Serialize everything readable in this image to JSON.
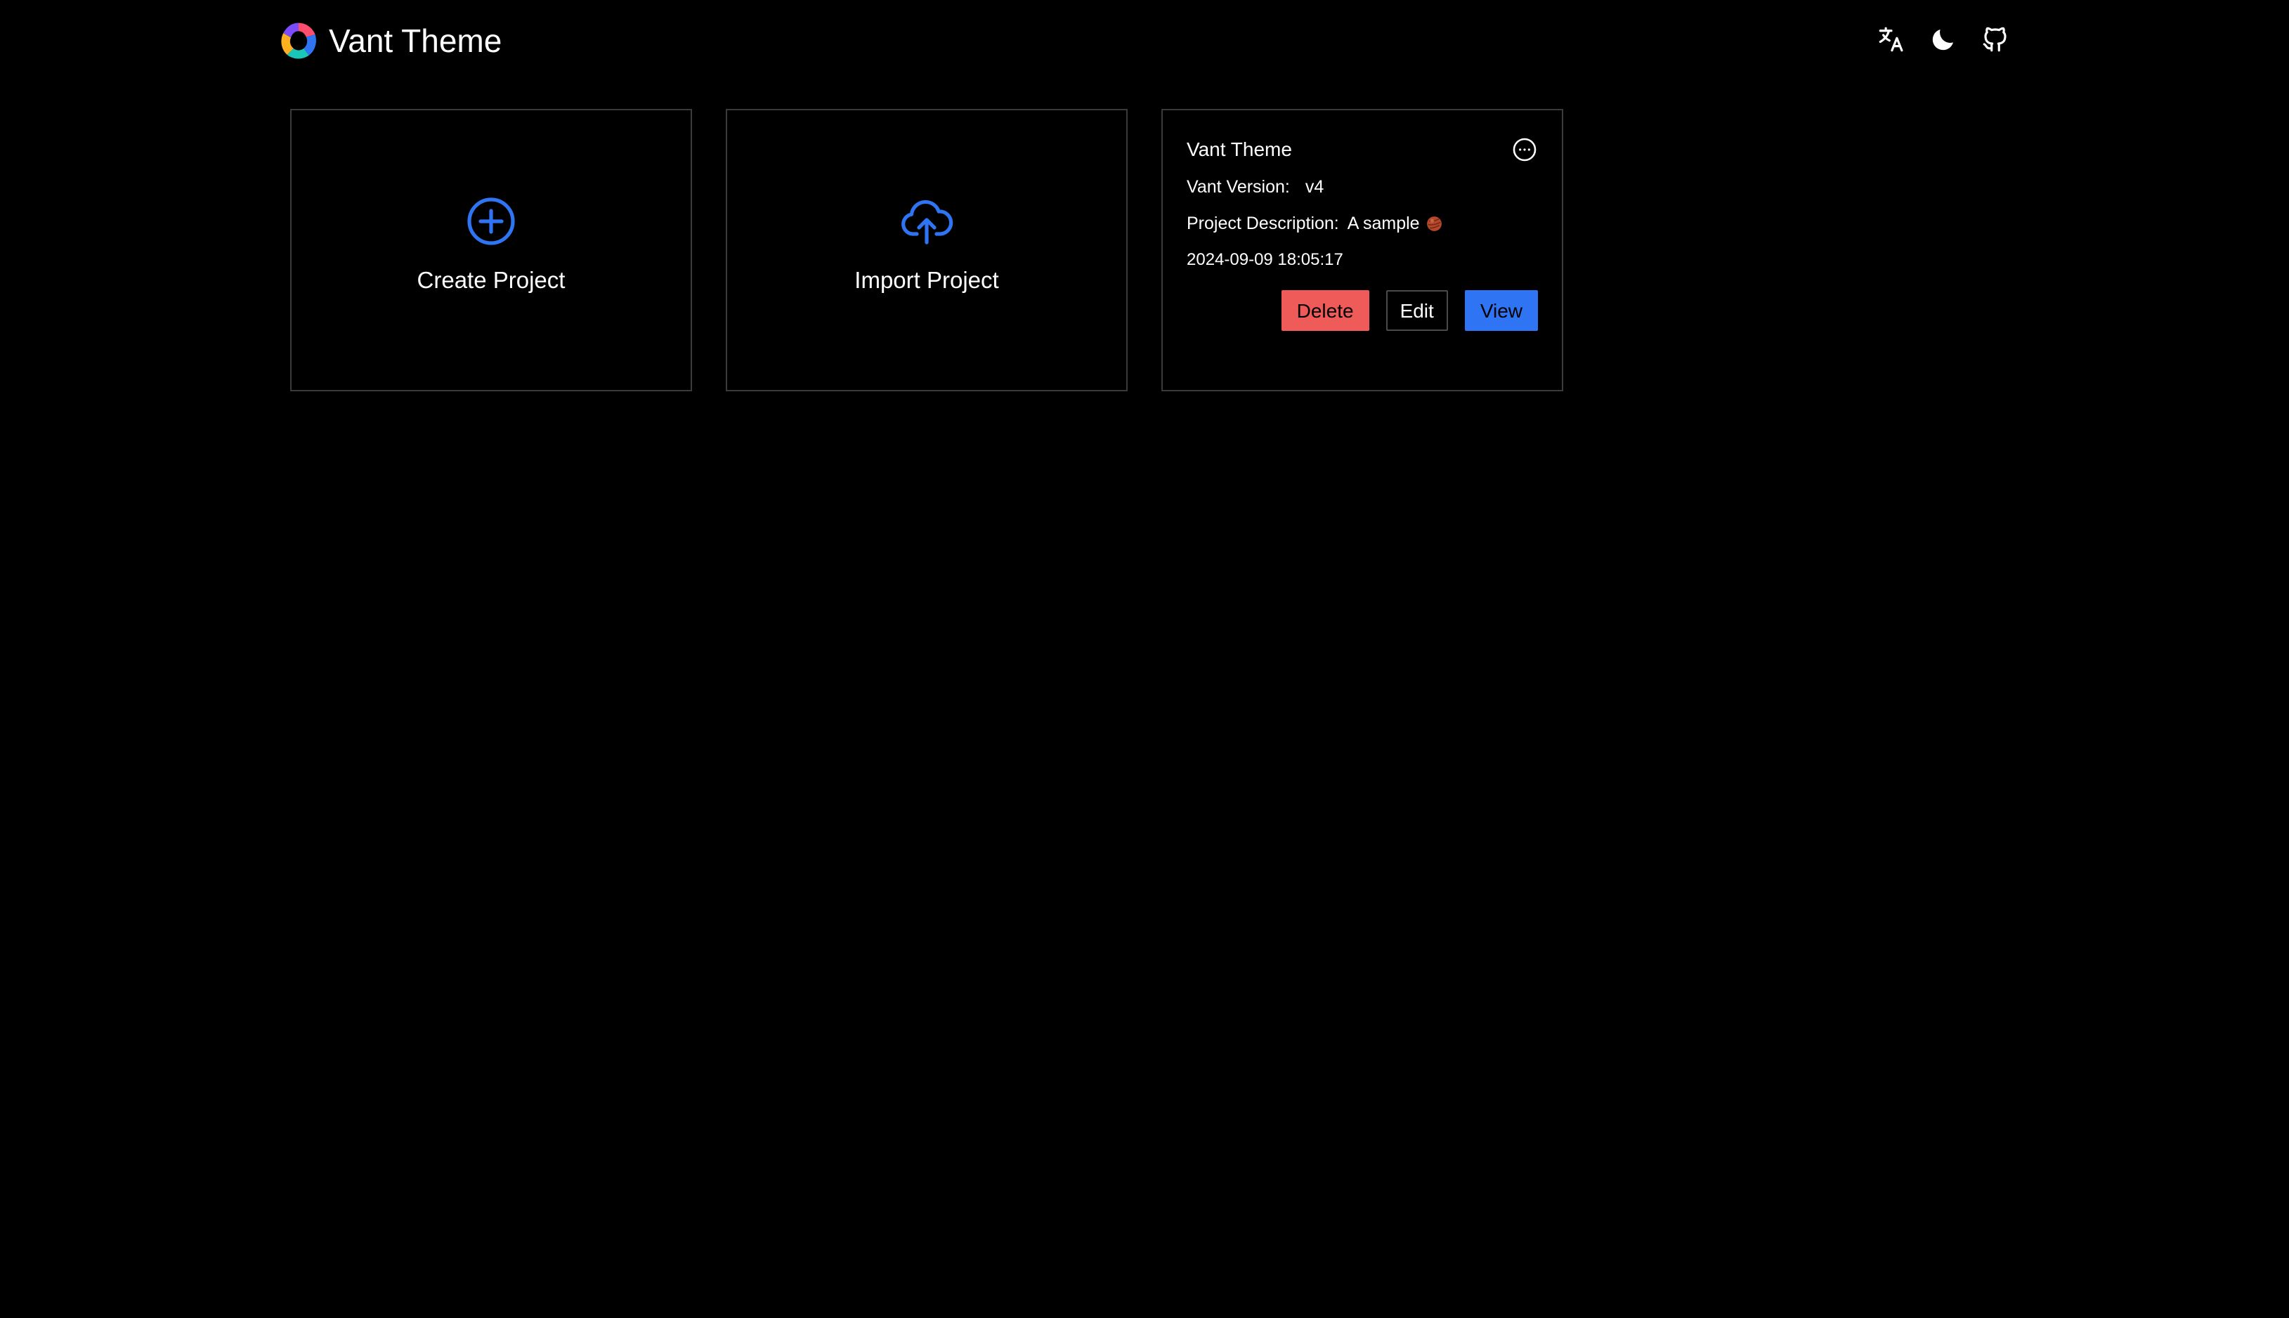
{
  "header": {
    "title": "Vant Theme",
    "logo_icon": "vant-logo-icon",
    "actions": [
      {
        "name": "translate-icon"
      },
      {
        "name": "moon-icon"
      },
      {
        "name": "github-icon"
      }
    ]
  },
  "cards": {
    "create": {
      "label": "Create Project",
      "icon": "plus-circle-icon"
    },
    "import": {
      "label": "Import Project",
      "icon": "cloud-upload-icon"
    }
  },
  "project": {
    "name": "Vant Theme",
    "version_label": "Vant Version:",
    "version_value": "v4",
    "description_label": "Project Description:",
    "description_value": "A sample",
    "timestamp": "2024-09-09 18:05:17",
    "delete_label": "Delete",
    "edit_label": "Edit",
    "view_label": "View"
  },
  "colors": {
    "background": "#000000",
    "accent": "#2f74f2",
    "danger": "#ee5b58",
    "border": "#3a3a3a"
  }
}
